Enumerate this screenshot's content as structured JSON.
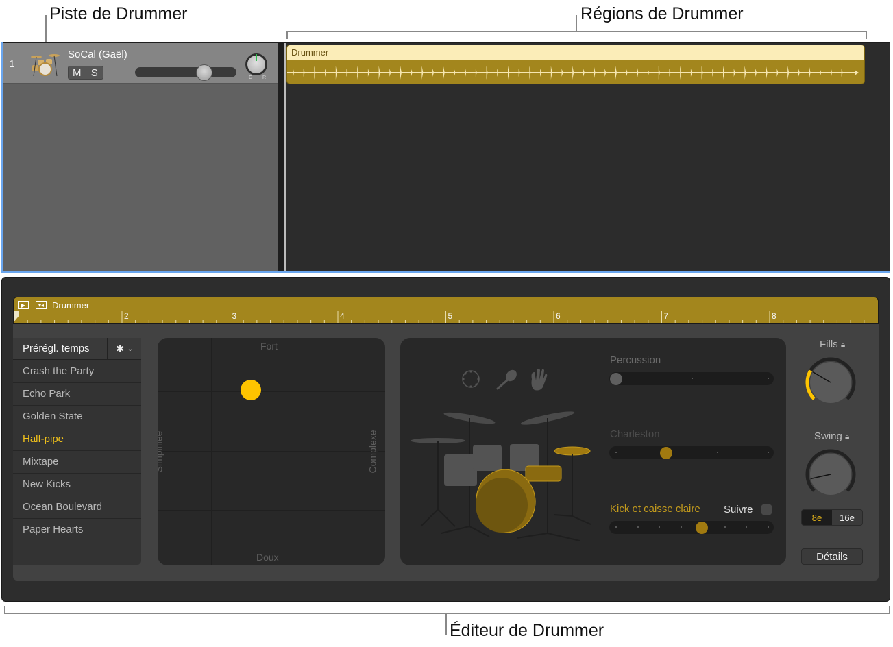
{
  "callouts": {
    "track": "Piste de Drummer",
    "regions": "Régions de Drummer",
    "editor": "Éditeur de Drummer"
  },
  "track": {
    "number": "1",
    "name": "SoCal (Gaël)",
    "mute_label": "M",
    "solo_label": "S",
    "volume_fraction": 0.72,
    "pan_left_label": "G",
    "pan_right_label": "R",
    "icon": "drum-kit-icon"
  },
  "region": {
    "title": "Drummer"
  },
  "editor": {
    "ruler": {
      "title": "Drummer",
      "bars": [
        "2",
        "3",
        "4",
        "5",
        "6",
        "7",
        "8"
      ]
    },
    "presets": {
      "title": "Prérégl. temps",
      "gear_icon": "gear-icon",
      "items": [
        "Crash the Party",
        "Echo Park",
        "Golden State",
        "Half-pipe",
        "Mixtape",
        "New Kicks",
        "Ocean Boulevard",
        "Paper Hearts"
      ],
      "selected": "Half-pipe"
    },
    "xypad": {
      "top": "Fort",
      "bottom": "Doux",
      "left": "Simplifiée",
      "right": "Complexe",
      "complexity": 0.41,
      "loudness": 0.77
    },
    "kit": {
      "instrument_icons": [
        "tambourine-icon",
        "shaker-icon",
        "handclap-icon"
      ],
      "percussion_label": "Percussion",
      "percussion_value": 0.0,
      "hihat_label": "Charleston",
      "hihat_value": 0.33,
      "kick_label": "Kick et caisse claire",
      "kick_value": 0.57,
      "follow_label": "Suivre",
      "follow_checked": false
    },
    "fills": {
      "label": "Fills",
      "value": 0.28,
      "locked": true
    },
    "swing": {
      "label": "Swing",
      "value": 0.12,
      "locked": true
    },
    "resolution": {
      "options": [
        "8e",
        "16e"
      ],
      "selected": "8e"
    },
    "details_label": "Détails"
  },
  "colors": {
    "accent_yellow": "#fec400",
    "region_gold": "#a3861d",
    "region_header": "#fbedb8",
    "kit_highlight": "#8a6a10",
    "selection_blue": "#6aa6ee"
  }
}
